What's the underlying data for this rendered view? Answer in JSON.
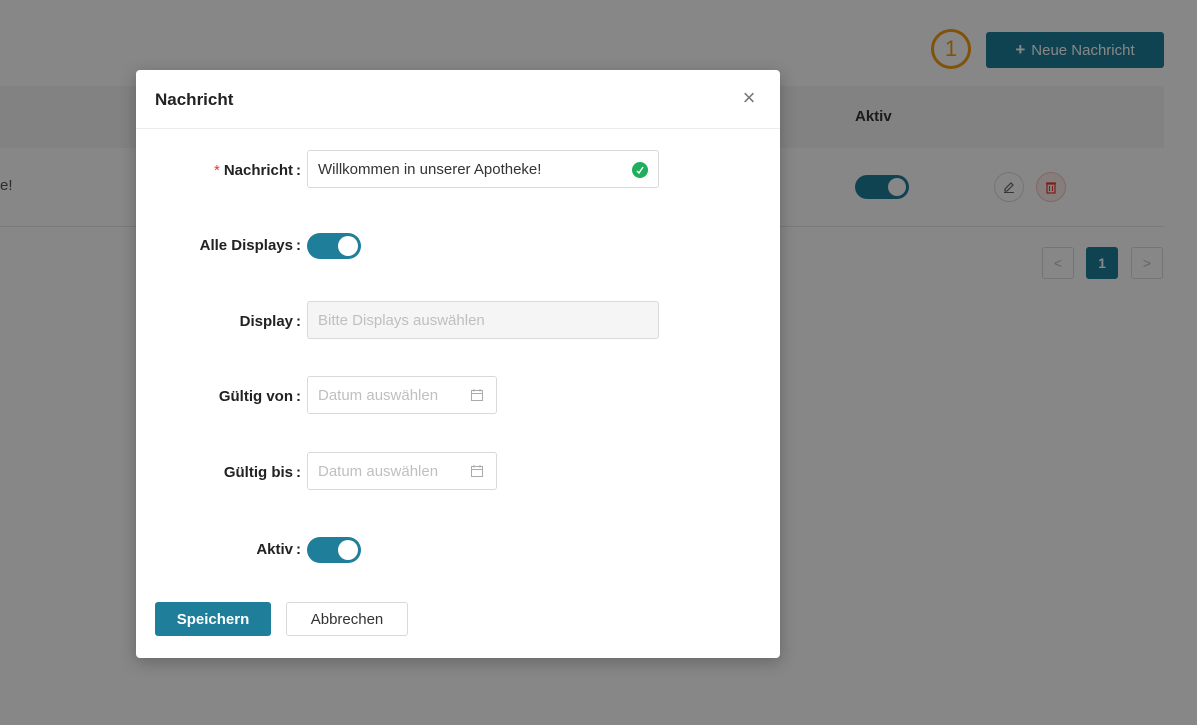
{
  "background": {
    "new_button_label": "Neue Nachricht",
    "annotation_number": "1",
    "table": {
      "header_aktiv": "Aktiv",
      "row_message_fragment": "e!",
      "row_active": true
    },
    "pagination": {
      "prev": "<",
      "current": "1",
      "next": ">"
    }
  },
  "modal": {
    "title": "Nachricht",
    "close_symbol": "×",
    "fields": {
      "nachricht": {
        "label": "Nachricht",
        "required_mark": "*",
        "value": "Willkommen in unserer Apotheke!"
      },
      "alle_displays": {
        "label": "Alle Displays",
        "value": true
      },
      "display": {
        "label": "Display",
        "placeholder": "Bitte Displays auswählen"
      },
      "gueltig_von": {
        "label": "Gültig von",
        "placeholder": "Datum auswählen"
      },
      "gueltig_bis": {
        "label": "Gültig bis",
        "placeholder": "Datum auswählen"
      },
      "aktiv": {
        "label": "Aktiv",
        "value": true
      }
    },
    "colon": ":",
    "buttons": {
      "save": "Speichern",
      "cancel": "Abbrechen"
    }
  },
  "colors": {
    "primary": "#1f7f9a",
    "annotation": "#f39c12",
    "danger": "#e53935"
  }
}
